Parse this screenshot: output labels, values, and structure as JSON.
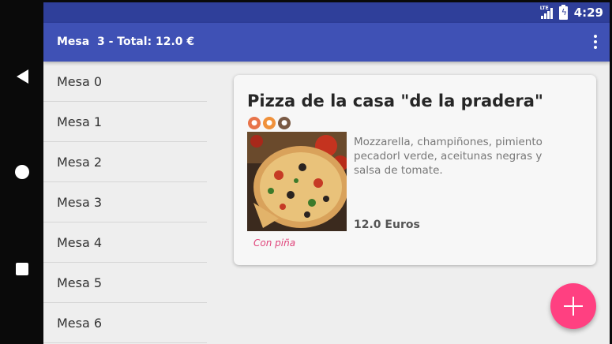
{
  "status_bar": {
    "network_label": "LTE",
    "time": "4:29",
    "icons": [
      "signal-icon",
      "battery-icon"
    ]
  },
  "app_bar": {
    "title": "Mesa  3 - Total: 12.0 €",
    "menu_icon": "more-vert-icon"
  },
  "tables": [
    {
      "label": "Mesa 0"
    },
    {
      "label": "Mesa 1"
    },
    {
      "label": "Mesa 2"
    },
    {
      "label": "Mesa 3"
    },
    {
      "label": "Mesa 4"
    },
    {
      "label": "Mesa 5"
    },
    {
      "label": "Mesa 6"
    }
  ],
  "order_card": {
    "title": "Pizza de la casa \"de la pradera\"",
    "badges": [
      "allergen-icon-1",
      "allergen-icon-2",
      "allergen-icon-3"
    ],
    "image": "pizza-image",
    "description": "Mozzarella, champiñones, pimiento pecadorl verde, aceitunas negras y salsa de tomate.",
    "price": "12.0 Euros",
    "note": "Con piña"
  },
  "fab": {
    "icon": "add-icon"
  },
  "nav": {
    "icons": [
      "back-icon",
      "home-icon",
      "recents-icon"
    ]
  },
  "colors": {
    "primary": "#3f51b5",
    "primary_dark": "#2f3f9a",
    "accent": "#ff4081",
    "note": "#e0457b"
  }
}
